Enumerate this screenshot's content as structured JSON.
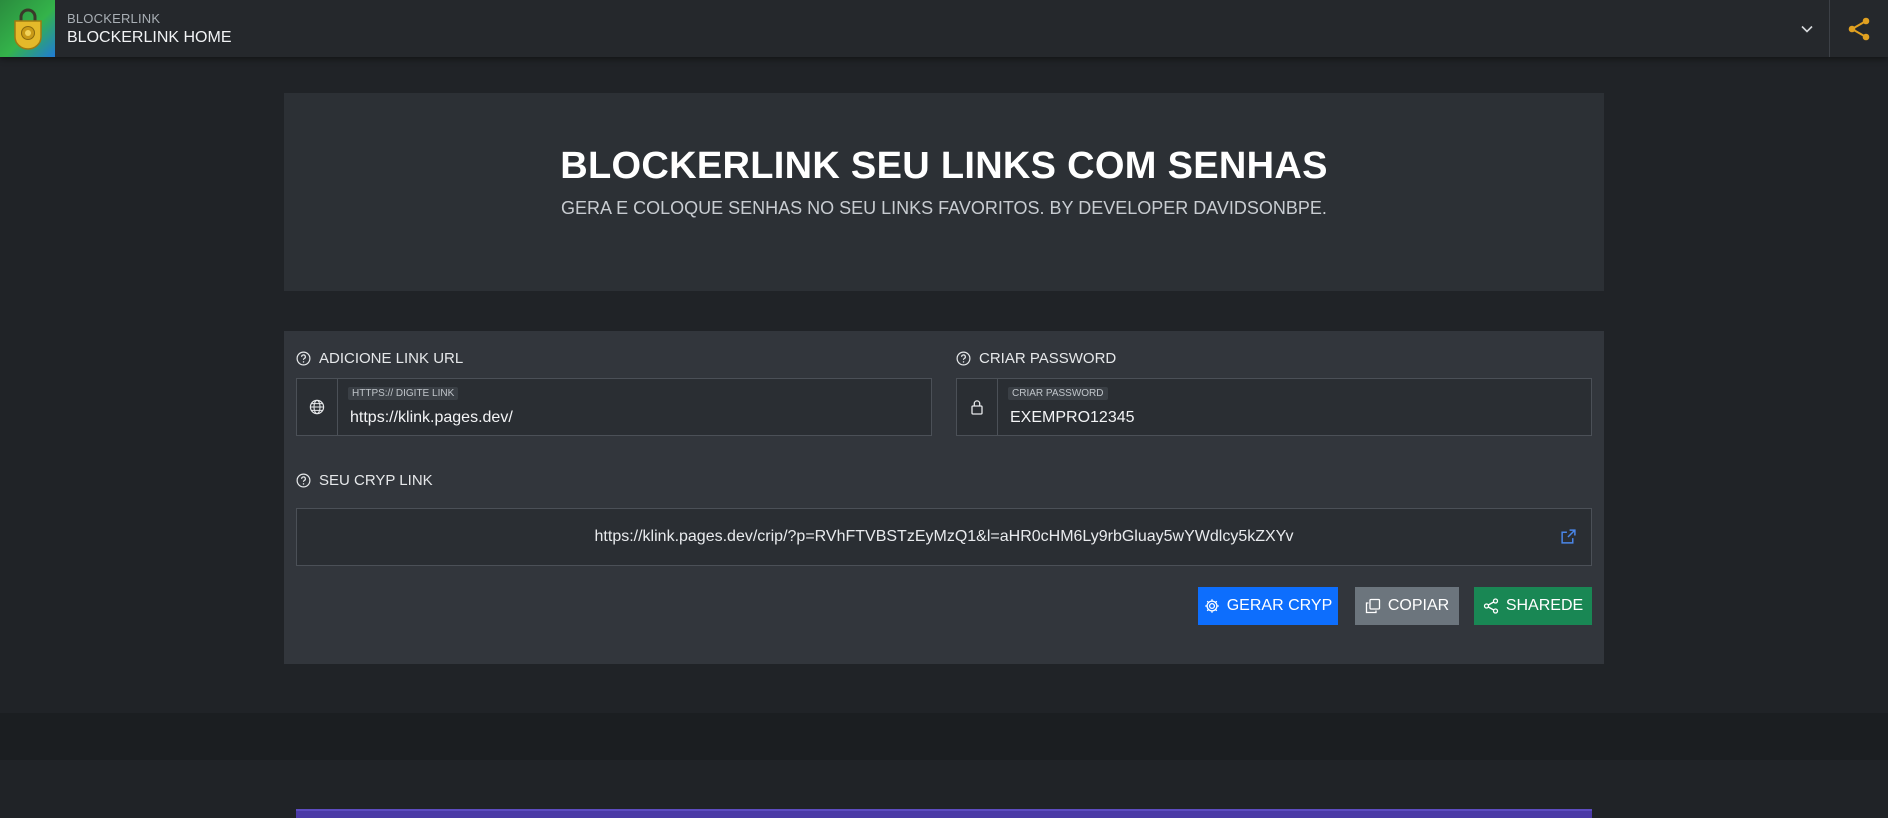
{
  "header": {
    "brand_small": "BLOCKERLINK",
    "brand_main": "BLOCKERLINK HOME",
    "accent_color": "#e0a020"
  },
  "hero": {
    "title": "BLOCKERLINK SEU LINKS COM SENHAS",
    "subtitle": "GERA E COLOQUE SENHAS NO SEU LINKS FAVORITOS. BY DEVELOPER DAVIDSONBPE."
  },
  "form": {
    "url_label": "ADICIONE LINK URL",
    "url_floating": "HTTPS:// DIGITE LINK",
    "url_value": "https://klink.pages.dev/",
    "password_label": "CRIAR PASSWORD",
    "password_floating": "CRIAR PASSWORD",
    "password_value": "EXEMPRO12345",
    "cryp_label": "SEU CRYP LINK",
    "cryp_link": "https://klink.pages.dev/crip/?p=RVhFTVBSTzEyMzQ1&l=aHR0cHM6Ly9rbGluay5wYWdlcy5kZXYv"
  },
  "buttons": {
    "generate": "GERAR CRYP",
    "copy": "COPIAR",
    "share": "SHAREDE"
  },
  "colors": {
    "primary": "#0d6efd",
    "secondary": "#6c757d",
    "success": "#198754"
  }
}
